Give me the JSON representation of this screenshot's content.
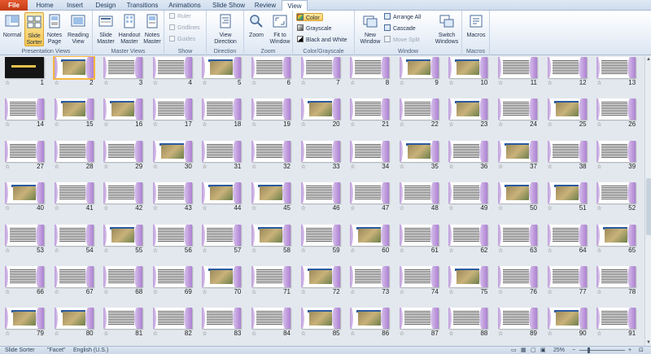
{
  "tabs": [
    "File",
    "Home",
    "Insert",
    "Design",
    "Transitions",
    "Animations",
    "Slide Show",
    "Review",
    "View"
  ],
  "active_tab": "View",
  "ribbon": {
    "presentation_views": {
      "label": "Presentation Views",
      "normal": "Normal",
      "slide_sorter": "Slide Sorter",
      "notes_page": "Notes Page",
      "reading_view": "Reading View"
    },
    "master_views": {
      "label": "Master Views",
      "slide_master": "Slide Master",
      "handout_master": "Handout Master",
      "notes_master": "Notes Master"
    },
    "show": {
      "label": "Show",
      "ruler": "Ruler",
      "gridlines": "Gridlines",
      "guides": "Guides"
    },
    "direction": {
      "label": "Direction",
      "view_direction": "View Direction"
    },
    "zoom": {
      "label": "Zoom",
      "zoom": "Zoom",
      "fit": "Fit to Window"
    },
    "color": {
      "label": "Color/Grayscale",
      "color": "Color",
      "grayscale": "Grayscale",
      "bw": "Black and White"
    },
    "window": {
      "label": "Window",
      "new_window": "New Window",
      "arrange_all": "Arrange All",
      "cascade": "Cascade",
      "move_split": "Move Split",
      "switch_windows": "Switch Windows"
    },
    "macros": {
      "label": "Macros",
      "macros": "Macros"
    }
  },
  "slides": {
    "selected": 2,
    "count": 91,
    "columns": 13
  },
  "status": {
    "view": "Slide Sorter",
    "theme": "\"Facet\"",
    "language": "English (U.S.)",
    "zoom": "25%"
  }
}
